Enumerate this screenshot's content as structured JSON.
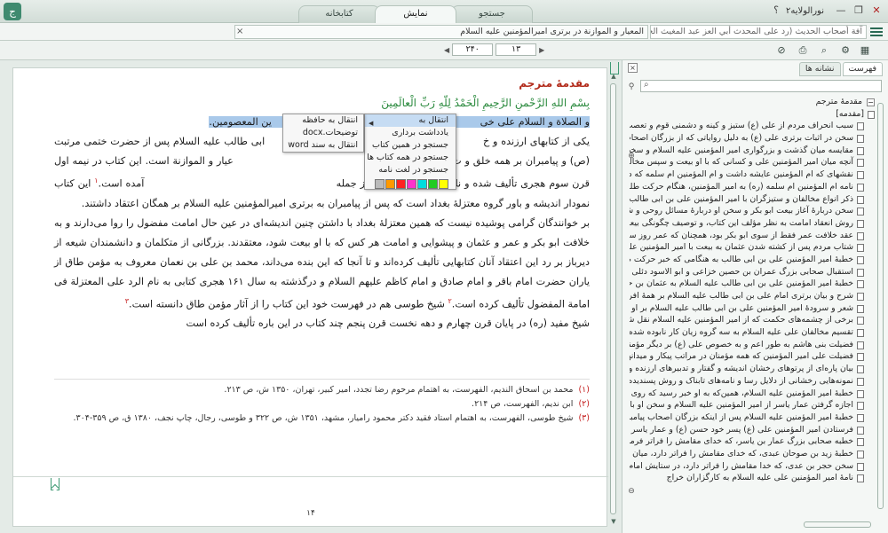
{
  "app": {
    "logo_glyph": "ج",
    "window_title": "نورالولایه۲",
    "help_icon": "؟",
    "minimize_icon": "—",
    "restore_icon": "❐",
    "close_icon": "✕",
    "tabs": [
      {
        "label": "کتابخانه",
        "active": false
      },
      {
        "label": "نمایش",
        "active": true
      },
      {
        "label": "جستجو",
        "active": false
      }
    ]
  },
  "docs": {
    "tab1": "آفة أصحاب الحديث (رد على المحدث أبي العز عبد المغيث الحنبلي و نقاش علمي حول صلاة أبي بكر في مرض رسول الله صلى الله عليه و آله و سلم)",
    "tab2": "المعيار و الموازنة در برتری امیرالمؤمنین علیه السلام",
    "close_glyph": "×"
  },
  "toolbar": {
    "page_current": "۱۳",
    "page_total": "۲۴۰"
  },
  "content": {
    "heading": "مقدمهٔ مترجم",
    "bismillah": "بِسْمِ اللهِ الرَّحْمنِ الرَّحِيمِ الْحَمْدُ لِلّهِ رَبِّ الْعالَمِينَ",
    "line1_start": "و الصلاة و السلام علی خی",
    "line1_end": "ین المعصومین.",
    "p2_a": "یکی از کتابهای ارزنده و خ",
    "p2_b": " ابی طالب علیه السلام پس از حضرت ختمی مرتبت (ص) و پیامبران بر همه خلق و ت",
    "p2_c": "عیار و الموازنة است. این کتاب در نیمه اول قرن سوم هجری تألیف شده و نام آن در منابع کهن و از جمله",
    "p2_d": " آمده است.",
    "fn1": "۱",
    "p2_e": " این کتاب نمودار اندیشه و باور گروه معتزلهٔ بغداد است که پس از پیامبران به برتری امیرالمؤمنین علیه السلام بر همگان اعتقاد داشتند.",
    "p3_a": "بر خوانندگان گرامی پوشیده نیست که همین معتزلهٔ بغداد با داشتن چنین اندیشه‌ای در عین حال امامت مفضول را روا می‌دارند و به خلافت ابو بکر و عمر و عثمان و پیشوایی و امامت هر کس که با او بیعت شود، معتقدند. بزرگانی از متکلمان و دانشمندان شیعه از دیرباز بر رد این اعتقاد آنان کتابهایی تألیف کرده‌اند و تا آنجا که این بنده می‌داند، محمد بن علی بن نعمان معروف به مؤمن طاق از یاران حضرت امام باقر و امام صادق و امام کاظم علیهم السلام و درگذشته به سال ۱۶۱ هجری کتابی به نام الرد علی المعتزلة فی امامة المفضول تألیف کرده است.",
    "fn2": "۲",
    "p3_b": " شیخ طوسی هم در فهرست خود این کتاب را از آثار مؤمن طاق دانسته است.",
    "fn3": "۳",
    "p4": "شیخ مفید (ره) در پایان قرن چهارم و دهه نخست قرن پنجم چند کتاب در این باره تألیف کرده است",
    "footnotes": [
      {
        "num": "(۱)",
        "text": "محمد بن اسحاق الندیم، الفهرست، به اهتمام مرحوم رضا تجدد، امیر کبیر، تهران، ۱۳۵۰ ش، ص ۲۱۳."
      },
      {
        "num": "(۲)",
        "text": "ابن ندیم، الفهرست، ص ۲۱۴."
      },
      {
        "num": "(۳)",
        "text": "شیخ طوسی، الفهرست، به اهتمام استاد فقید دکتر محمود رامیار، مشهد، ۱۳۵۱ ش، ص ۳۲۲ و طوسی، رجال، چاپ نجف، ۱۳۸۰ ق، ص ۳۵۹-۳۰۴."
      }
    ],
    "page_number": "۱۴"
  },
  "context_menu": {
    "goto": "انتقال به",
    "note": "یادداشت برداری",
    "search_book": "جستجو در همین کتاب",
    "search_all": "جستجو در همه کتاب ها",
    "search_dict": "جستجو در لغت نامه",
    "submenu_arrow": "◀",
    "swatches": [
      "#ffff00",
      "#22cc22",
      "#00dddd",
      "#ff33cc",
      "#ff2222",
      "#ff9900",
      "#bbbbbb"
    ]
  },
  "submenu": {
    "clipboard": "انتقال به حافظه",
    "docx": "توضیحات.docx",
    "word": "انتقال به سند word"
  },
  "sidebar": {
    "tab_index": "فهرست",
    "tab_bookmarks": "نشانه ها",
    "close_glyph": "×",
    "collapse_glyph": "−",
    "items": [
      "مقدمهٔ مترجم",
      "[مقدمه]",
      "سبب انحراف مردم از علی (ع) ستیز و کینه و دشمنی قوم و تعصب جاهلی است",
      "سخن در اثبات برتری علی (ع) به دلیل روایاتی که از بزرگان اصحاب نقل شده است",
      "مقایسه میان گذشت و بزرگواری امیر المؤمنین علیه السلام و سخت‌گیری و تندخویی کسانی",
      "آنچه میان امیر المؤمنین علی و کسانی که با او بیعت و سپس مخالفت کردند، گذشت",
      "نقشهای که ام المؤمنین عایشه داشت و ام المؤمنین ام سلمه که درود خداوند بر او باد",
      "نامه ام المؤمنین ام سلمه (ره) به امیر المؤمنین، هنگام حرکت طلحه و زبیر و عایشه",
      "ذکر انواع مخالفان و ستیزگران با امیر المؤمنین علی بن ابی طالب علیه السلام",
      "سخن دربارهٔ آغاز بیعت ابو بکر و سخن او دربارهٔ مسائل روحی و شخصیت خویش",
      "روش انعقاد امامت به نظر مؤلف این کتاب، و توصیف چگونگی بیعت مردم با امیر المؤمنین",
      "عقد خلافت عمر فقط از سوی ابو بکر بود، همچنان که عمر روز سقیفه آن را برای ابو بکر بست",
      "شتاب مردم پس از کشته شدن عثمان به بیعت با امیر المؤمنین علی و هجوم آوردن آنان",
      "خطبهٔ امیر المؤمنین علی بن ابی طالب به هنگامی که خبر حرکت طلحه و زبیر و عایشه رسید",
      "استقبال صحابی بزرگ عمران بن حصین خزاعی و ابو الاسود دئلی از عایشه در بصره",
      "خطبهٔ امیر المؤمنین علی بن ابی طالب علیه السلام به عثمان بن حنیف والی خود بر بصره",
      "شرح و بیان برتری امام علی بن ابی طالب علیه السلام بر همهٔ افراد بشر پس از پیامبر",
      "شعر و سرودهٔ امیر المؤمنین علی بن ابی طالب علیه السلام بر او اسلام و گردن نهادن",
      "برخی از چشمه‌های حکمت که از امیر المؤمنین علیه السلام نقل شده است",
      "تقسیم مخالفان علی علیه السلام به سه گروه زیان کار نابوده شده",
      "فضیلت بنی هاشم به طور اعم و به خصوص علی (ع) بر دیگر مؤمنان به سبب نسب",
      "فضیلت علی امیر المؤمنین که همه مؤمنان در مراتب پیکار و میدانهای جانفشانی",
      "بیان پاره‌ای از پرتوهای رخشان اندیشه و گفتار و تدبیرهای ارزنده و صحیح علوی",
      "نمونه‌هایی رخشانی از دلایل رسا و نامه‌های تابناک و روش پسندیده و اندیشهٔ درست",
      "خطبهٔ امیر المؤمنین علیه السلام، همین‌که به او خبر رسید که روی گردانندگان از او",
      "اجازه گرفتن عمار یاسر از امیر المؤمنین علیه السلام و سخن او با محمد بن مسلمه",
      "خطبهٔ امیر المؤمنین علیه السلام پس از اینکه بزرگان اصحاب پیامبر (ص) به او",
      "فرستادن امیر المؤمنین علی (ع) پسر خود حسن (ع) و عمار یاسر را به کوفه برای بسیج",
      "خطبه صحابی بزرگ عمار بن یاسر، که خدای مقامش را فراتر فرماید، میان مردم کوفه",
      "خطبهٔ زید بن صوحان عبدی، که خدای مقامش را فراتر دارد، میان مردم کوفه و بصره",
      "سخن حجر بن عدی، که خدا مقامش را فراتر دارد، در ستایش امام حسن و برائت",
      "نامهٔ امیر المؤمنین علی علیه السلام به کارگزاران خراج"
    ]
  }
}
